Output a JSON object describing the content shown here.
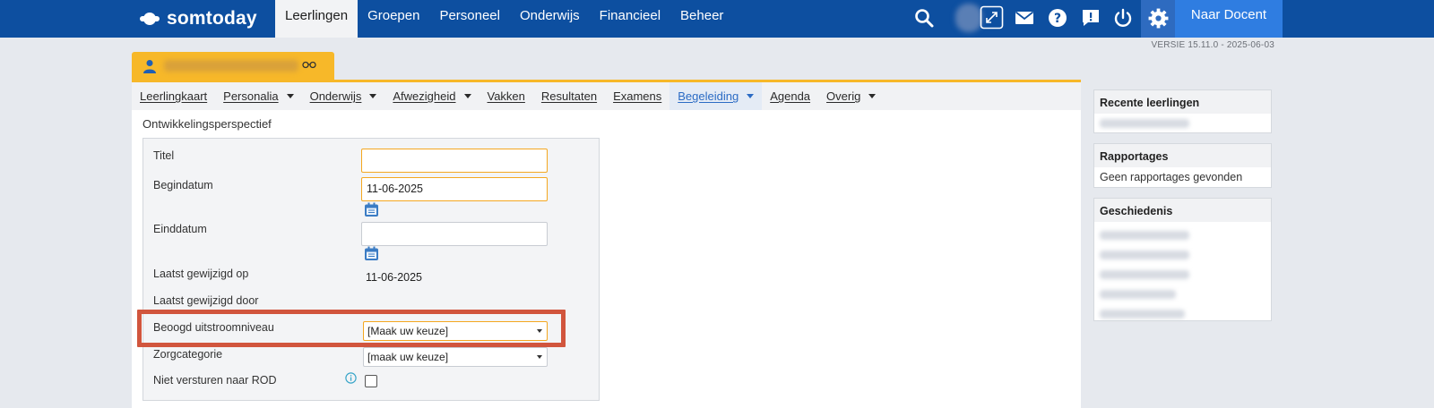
{
  "app": {
    "logo_text": "somtoday"
  },
  "main_nav": [
    {
      "label": "Leerlingen",
      "active": true
    },
    {
      "label": "Groepen"
    },
    {
      "label": "Personeel"
    },
    {
      "label": "Onderwijs"
    },
    {
      "label": "Financieel"
    },
    {
      "label": "Beheer"
    }
  ],
  "toolbar": {
    "naar_docent_label": "Naar Docent"
  },
  "icons": [
    "search-icon",
    "user-avatar",
    "fullscreen-icon",
    "mail-icon",
    "help-icon",
    "feedback-icon",
    "power-icon",
    "gear-icon"
  ],
  "version": "VERSIE 15.11.0 - 2025-06-03",
  "sub_nav": [
    {
      "label": "Leerlingkaart",
      "dropdown": false
    },
    {
      "label": "Personalia",
      "dropdown": true
    },
    {
      "label": "Onderwijs",
      "dropdown": true
    },
    {
      "label": "Afwezigheid",
      "dropdown": true
    },
    {
      "label": "Vakken",
      "dropdown": false
    },
    {
      "label": "Resultaten",
      "dropdown": false
    },
    {
      "label": "Examens",
      "dropdown": false
    },
    {
      "label": "Begeleiding",
      "dropdown": true,
      "active": true
    },
    {
      "label": "Agenda",
      "dropdown": false
    },
    {
      "label": "Overig",
      "dropdown": true
    }
  ],
  "form": {
    "section_title": "Ontwikkelingsperspectief",
    "titel_label": "Titel",
    "titel_value": "",
    "begindatum_label": "Begindatum",
    "begindatum_value": "11-06-2025",
    "einddatum_label": "Einddatum",
    "einddatum_value": "",
    "gewijzigd_op_label": "Laatst gewijzigd op",
    "gewijzigd_op_value": "11-06-2025",
    "gewijzigd_door_label": "Laatst gewijzigd door",
    "uitstroom_label": "Beoogd uitstroomniveau",
    "uitstroom_value": "[Maak uw keuze]",
    "zorg_label": "Zorgcategorie",
    "zorg_value": "[maak uw keuze]",
    "rod_label": "Niet versturen naar ROD"
  },
  "sidebar": {
    "recent_title": "Recente leerlingen",
    "rapportages_title": "Rapportages",
    "rapportages_empty": "Geen rapportages gevonden",
    "geschiedenis_title": "Geschiedenis"
  },
  "colors": {
    "topbar": "#0d4fa0",
    "accent_orange": "#f7b829",
    "highlight_red": "#d1553d",
    "active_subnav": "#2b6bc4"
  }
}
